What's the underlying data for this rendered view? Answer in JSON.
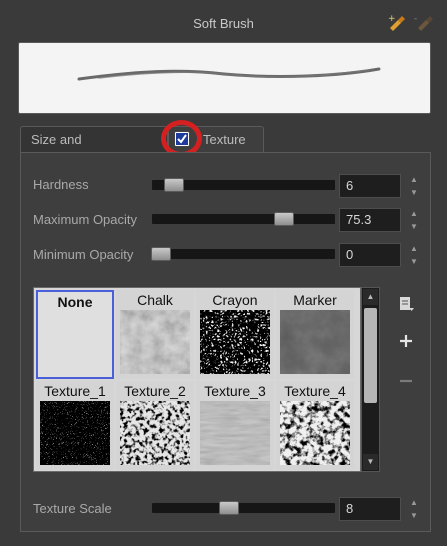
{
  "header": {
    "title": "Soft Brush",
    "icons": [
      "brush-add-icon",
      "brush-delete-icon"
    ]
  },
  "tabs": [
    {
      "label": "Size and Smoothness",
      "active": false
    },
    {
      "label": "Texture",
      "active": true,
      "checked": true
    }
  ],
  "sliders": [
    {
      "label": "Hardness",
      "value": "6",
      "fraction": 0.12
    },
    {
      "label": "Maximum Opacity",
      "value": "75.3",
      "fraction": 0.72
    },
    {
      "label": "Minimum Opacity",
      "value": "0",
      "fraction": 0.05
    }
  ],
  "textures": [
    "None",
    "Chalk",
    "Crayon",
    "Marker",
    "Texture_1",
    "Texture_2",
    "Texture_3",
    "Texture_4"
  ],
  "selected_texture": "None",
  "texture_scale": {
    "label": "Texture Scale",
    "value": "8",
    "fraction": 0.42
  },
  "colors": {
    "panel": "#3a3a3a",
    "selection": "#4a60d8",
    "highlight_ring": "#d42020"
  }
}
